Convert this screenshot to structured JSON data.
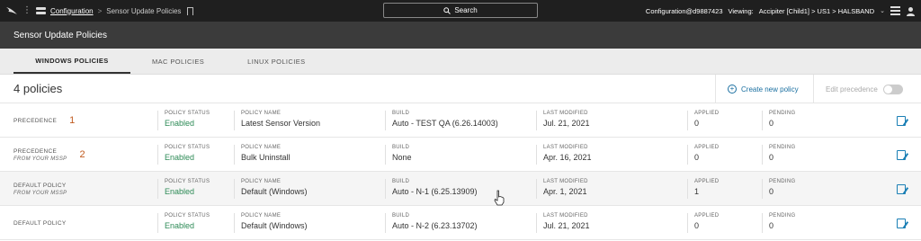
{
  "topbar": {
    "breadcrumb_link": "Configuration",
    "breadcrumb_sep": ">",
    "breadcrumb_current": "Sensor Update Policies",
    "search_label": "Search",
    "user": "Configuration@d9887423",
    "viewing_label": "Viewing:",
    "viewing_value": "Accipiter [Child1] > US1 > HALSBAND",
    "icons": [
      "falcon-logo-icon",
      "kebab-icon",
      "apps-icon",
      "bookmark-icon",
      "search-icon",
      "chevron-down-icon",
      "notes-icon",
      "user-icon"
    ]
  },
  "header": {
    "title": "Sensor Update Policies"
  },
  "tabs": [
    {
      "label": "WINDOWS POLICIES",
      "active": true
    },
    {
      "label": "MAC POLICIES",
      "active": false
    },
    {
      "label": "LINUX POLICIES",
      "active": false
    }
  ],
  "toolbar": {
    "count": "4 policies",
    "create_label": "Create new policy",
    "edit_precedence_label": "Edit precedence"
  },
  "columns": {
    "status": "POLICY STATUS",
    "name": "POLICY NAME",
    "build": "BUILD",
    "modified": "LAST MODIFIED",
    "applied": "APPLIED",
    "pending": "PENDING"
  },
  "rows": [
    {
      "precedence_label": "PRECEDENCE",
      "precedence_sub": "",
      "precedence_num": "1",
      "status": "Enabled",
      "name": "Latest Sensor Version",
      "build": "Auto - TEST QA (6.26.14003)",
      "modified": "Jul. 21, 2021",
      "applied": "0",
      "pending": "0"
    },
    {
      "precedence_label": "PRECEDENCE",
      "precedence_sub": "FROM YOUR MSSP",
      "precedence_num": "2",
      "status": "Enabled",
      "name": "Bulk Uninstall",
      "build": "None",
      "modified": "Apr. 16, 2021",
      "applied": "0",
      "pending": "0"
    },
    {
      "precedence_label": "DEFAULT POLICY",
      "precedence_sub": "FROM YOUR MSSP",
      "precedence_num": "",
      "status": "Enabled",
      "name": "Default (Windows)",
      "build": "Auto - N-1 (6.25.13909)",
      "modified": "Apr. 1, 2021",
      "applied": "1",
      "pending": "0"
    },
    {
      "precedence_label": "DEFAULT POLICY",
      "precedence_sub": "",
      "precedence_num": "",
      "status": "Enabled",
      "name": "Default (Windows)",
      "build": "Auto - N-2 (6.23.13702)",
      "modified": "Jul. 21, 2021",
      "applied": "0",
      "pending": "0"
    }
  ],
  "colors": {
    "accent": "#1a6fa0",
    "enabled": "#2e8b57",
    "precedence": "#c05a1e",
    "topbar": "#1f1f1f",
    "header": "#3b3b3b"
  }
}
